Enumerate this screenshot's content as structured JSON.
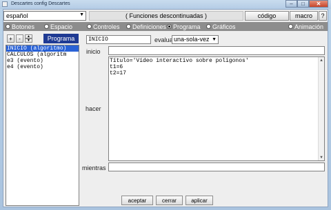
{
  "window": {
    "title": "Descartes config Descartes",
    "minimize_glyph": "–",
    "maximize_glyph": "□",
    "close_glyph": "✕"
  },
  "toolbar": {
    "language": "español",
    "functions_label": "( Funciones descontinuadas )",
    "codigo_label": "código",
    "macro_label": "macro",
    "help_label": "?"
  },
  "tabs": [
    {
      "label": "Botones",
      "selected": false
    },
    {
      "label": "Espacio",
      "selected": false
    },
    {
      "label": "Controles",
      "selected": false
    },
    {
      "label": "Definiciones",
      "selected": false
    },
    {
      "label": "Programa",
      "selected": true
    },
    {
      "label": "Gráficos",
      "selected": false
    },
    {
      "label": "Animación",
      "selected": false
    }
  ],
  "left_panel": {
    "add_label": "+",
    "remove_label": "-",
    "up_label": "▲",
    "down_label": "▼",
    "title": "Programa",
    "items": [
      {
        "label": "INICIO (algoritmo)",
        "selected": true
      },
      {
        "label": "CALCULOS (algoritm",
        "selected": false
      },
      {
        "label": "e3 (evento)",
        "selected": false
      },
      {
        "label": "e4 (evento)",
        "selected": false
      }
    ]
  },
  "editor": {
    "name_value": "INICIO",
    "evaluar_label": "evaluar",
    "evaluar_value": "una-sola-vez",
    "inicio_label": "inicio",
    "inicio_value": "",
    "hacer_label": "hacer",
    "hacer_lines": [
      "Título='Vídeo interactivo sobre polígonos'",
      "t1=6",
      "t2=17"
    ],
    "mientras_label": "mientras",
    "mientras_value": ""
  },
  "footer": {
    "aceptar_label": "aceptar",
    "cerrar_label": "cerrar",
    "aplicar_label": "aplicar"
  },
  "colors": {
    "tab_bar": "#8d8d8d",
    "selection": "#2a62d6",
    "program_label_bg": "#1f3a93"
  }
}
